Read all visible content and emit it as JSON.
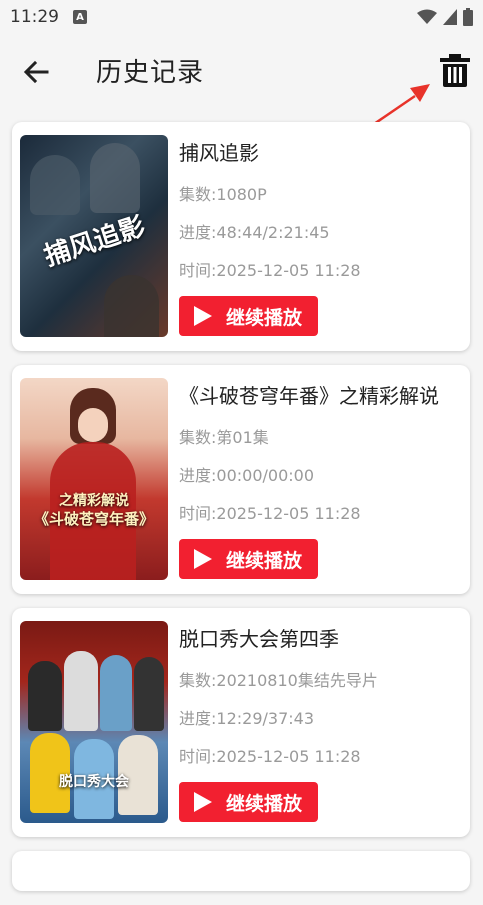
{
  "status_bar": {
    "time": "11:29",
    "notification_letter": "A"
  },
  "header": {
    "title": "历史记录"
  },
  "history": [
    {
      "title": "捕风追影",
      "poster_caption": "捕风追影",
      "episode": "集数:1080P",
      "progress": "进度:48:44/2:21:45",
      "time": "时间:2025-12-05 11:28",
      "button_label": "继续播放"
    },
    {
      "title": "《斗破苍穹年番》之精彩解说",
      "poster_caption_top": "之精彩解说",
      "poster_caption": "《斗破苍穹年番》",
      "episode": "集数:第01集",
      "progress": "进度:00:00/00:00",
      "time": "时间:2025-12-05 11:28",
      "button_label": "继续播放"
    },
    {
      "title": "脱口秀大会第四季",
      "poster_caption": "脱口秀大会",
      "episode": "集数:20210810集结先导片",
      "progress": "进度:12:29/37:43",
      "time": "时间:2025-12-05 11:28",
      "button_label": "继续播放"
    }
  ],
  "colors": {
    "accent": "#f22030",
    "annotation": "#e8332a"
  }
}
